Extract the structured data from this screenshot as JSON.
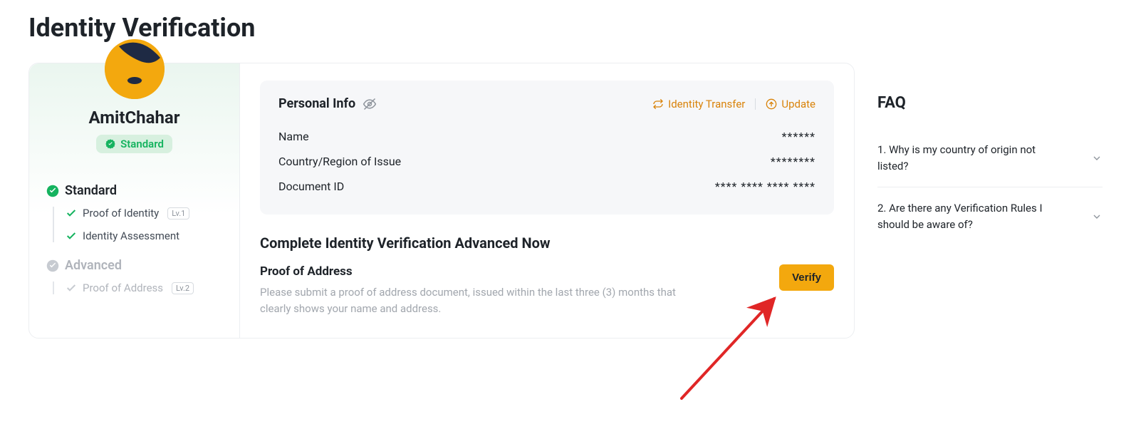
{
  "page": {
    "title": "Identity Verification"
  },
  "profile": {
    "username": "AmitChahar",
    "badge": "Standard"
  },
  "levels": {
    "standard": {
      "label": "Standard",
      "items": [
        {
          "label": "Proof of Identity",
          "tag": "Lv.1"
        },
        {
          "label": "Identity Assessment",
          "tag": ""
        }
      ]
    },
    "advanced": {
      "label": "Advanced",
      "items": [
        {
          "label": "Proof of Address",
          "tag": "Lv.2"
        }
      ]
    }
  },
  "personalInfo": {
    "title": "Personal Info",
    "actions": {
      "transfer": "Identity Transfer",
      "update": "Update"
    },
    "rows": [
      {
        "label": "Name",
        "value": "******"
      },
      {
        "label": "Country/Region of Issue",
        "value": "********"
      },
      {
        "label": "Document ID",
        "value": "**** **** **** ****"
      }
    ]
  },
  "advancedSection": {
    "heading": "Complete Identity Verification Advanced Now",
    "subheading": "Proof of Address",
    "description": "Please submit a proof of address document, issued within the last three (3) months that clearly shows your name and address.",
    "button": "Verify"
  },
  "faq": {
    "title": "FAQ",
    "items": [
      "1. Why is my country of origin not listed?",
      "2. Are there any Verification Rules I should be aware of?"
    ]
  }
}
